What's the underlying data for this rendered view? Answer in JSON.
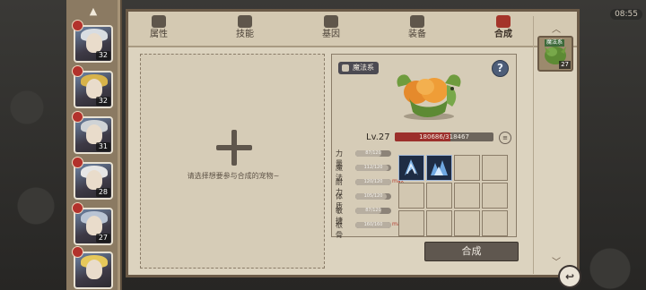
{
  "timer": "08:55",
  "tabs": [
    {
      "label": "属性",
      "active": false
    },
    {
      "label": "技能",
      "active": false
    },
    {
      "label": "基因",
      "active": false
    },
    {
      "label": "装备",
      "active": false
    },
    {
      "label": "合成",
      "active": true
    }
  ],
  "characters": [
    {
      "level": "32",
      "hair_color": "#d8dde2",
      "icon": "character-avatar"
    },
    {
      "level": "32",
      "hair_color": "#d7b34a",
      "icon": "character-avatar"
    },
    {
      "level": "31",
      "hair_color": "#cfd3d6",
      "icon": "character-avatar"
    },
    {
      "level": "28",
      "hair_color": "#e6e6e6",
      "icon": "character-avatar"
    },
    {
      "level": "27",
      "hair_color": "#b9c4d4",
      "icon": "character-avatar"
    },
    {
      "level": "",
      "hair_color": "#e6c85a",
      "icon": "character-avatar"
    }
  ],
  "add_area": {
    "hint": "请选择想要参与合成的宠物~"
  },
  "pet": {
    "tag": "魔法系",
    "level": "Lv.27",
    "hp_text": "180686/318467",
    "hp_fraction": 0.567,
    "stats": [
      {
        "name": "力量",
        "value": "87/120",
        "fill": 0.72,
        "max": ""
      },
      {
        "name": "魔法",
        "value": "112/120",
        "fill": 0.93,
        "max": ""
      },
      {
        "name": "耐力",
        "value": "120/120",
        "fill": 1.0,
        "max": "max"
      },
      {
        "name": "体质",
        "value": "105/120",
        "fill": 0.87,
        "max": ""
      },
      {
        "name": "敏捷",
        "value": "87/120",
        "fill": 0.72,
        "max": ""
      },
      {
        "name": "根骨",
        "value": "160/160",
        "fill": 1.0,
        "max": "max"
      }
    ]
  },
  "confirm_label": "合成",
  "right_pet": {
    "name": "魔法系",
    "level": "27"
  },
  "colors": {
    "panel": "#dcd3bf",
    "accent_red": "#9c2f2b",
    "button": "#5f574f"
  }
}
